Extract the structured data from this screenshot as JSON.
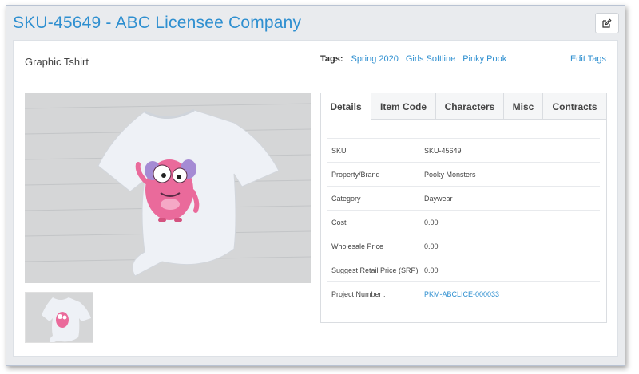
{
  "header": {
    "title": "SKU-45649 - ABC Licensee Company",
    "edit_icon": "pencil-square-icon"
  },
  "product": {
    "name": "Graphic Tshirt"
  },
  "tags": {
    "label": "Tags:",
    "items": [
      "Spring 2020",
      "Girls Softline",
      "Pinky Pook"
    ],
    "edit_label": "Edit Tags"
  },
  "tabs": [
    {
      "label": "Details",
      "active": true
    },
    {
      "label": "Item Code",
      "active": false
    },
    {
      "label": "Characters",
      "active": false
    },
    {
      "label": "Misc",
      "active": false
    },
    {
      "label": "Contracts",
      "active": false
    }
  ],
  "details": [
    {
      "key": "SKU",
      "value": "SKU-45649"
    },
    {
      "key": "Property/Brand",
      "value": "Pooky Monsters"
    },
    {
      "key": "Category",
      "value": "Daywear"
    },
    {
      "key": "Cost",
      "value": "0.00"
    },
    {
      "key": "Wholesale Price",
      "value": "0.00"
    },
    {
      "key": "Suggest Retail Price (SRP)",
      "value": "0.00"
    },
    {
      "key": "Project Number :",
      "value": "PKM-ABCLICE-000033"
    }
  ],
  "colors": {
    "accent": "#2e8fd0",
    "background": "#e9ebee",
    "shirt": "#f1f4f8",
    "monster": "#ec6b9c"
  }
}
